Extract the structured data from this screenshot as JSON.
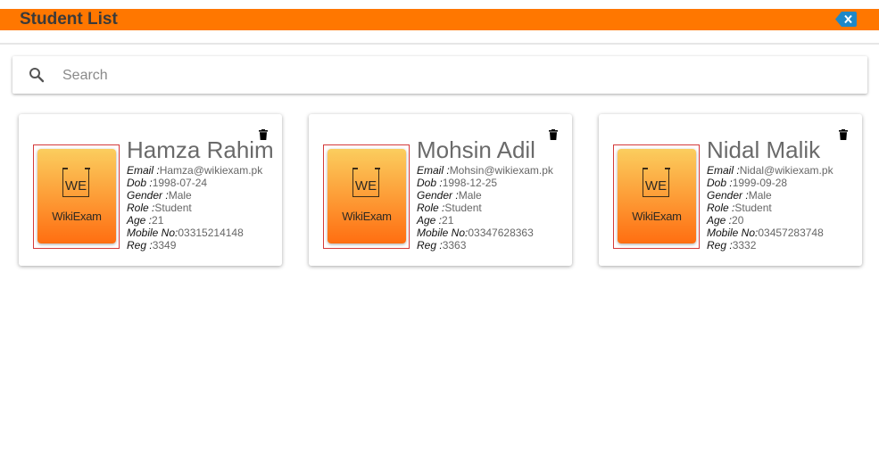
{
  "header": {
    "title": "Student List",
    "accent_color": "#ff7700"
  },
  "search": {
    "placeholder": "Search",
    "value": ""
  },
  "labels": {
    "email": "Email :",
    "dob": "Dob :",
    "gender": "Gender :",
    "role": "Role :",
    "age": "Age :",
    "mobile": "Mobile No:",
    "reg": "Reg :"
  },
  "logo": {
    "top": "WE",
    "bottom": "WikiExam"
  },
  "students": [
    {
      "name": "Hamza Rahim",
      "email": "Hamza@wikiexam.pk",
      "dob": "1998-07-24",
      "gender": "Male",
      "role": "Student",
      "age": "21",
      "mobile": "03315214148",
      "reg": "3349"
    },
    {
      "name": "Mohsin Adil",
      "email": "Mohsin@wikiexam.pk",
      "dob": "1998-12-25",
      "gender": "Male",
      "role": "Student",
      "age": "21",
      "mobile": "03347628363",
      "reg": "3363"
    },
    {
      "name": "Nidal Malik",
      "email": "Nidal@wikiexam.pk",
      "dob": "1999-09-28",
      "gender": "Male",
      "role": "Student",
      "age": "20",
      "mobile": "03457283748",
      "reg": "3332"
    }
  ]
}
